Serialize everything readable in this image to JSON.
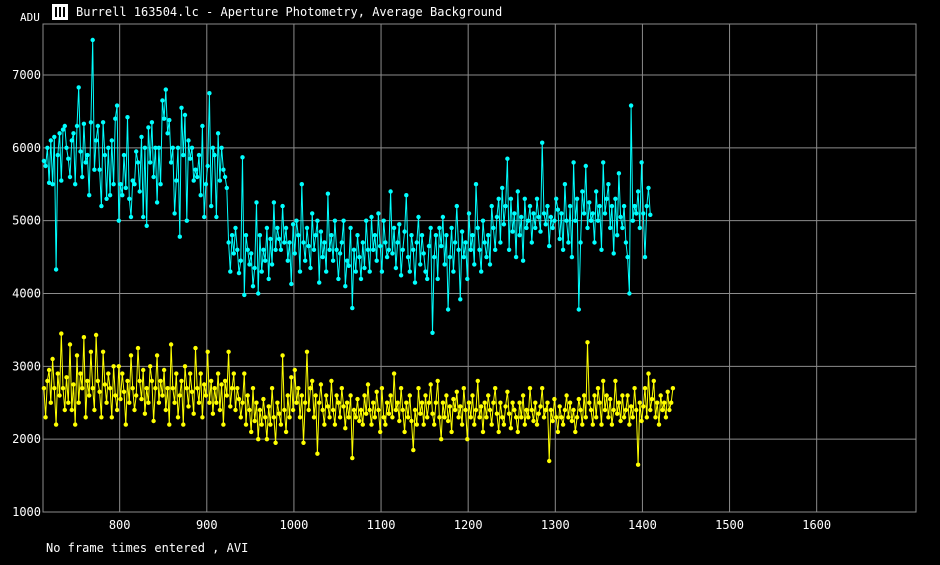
{
  "window": {
    "title": "Burrell 163504.lc - Aperture Photometry, Average Background",
    "icon": "lightcurve-app-icon"
  },
  "status_text": "No frame times entered , AVI",
  "colors": {
    "background": "#000000",
    "grid": "#8c8c8c",
    "series_target": "#00ffff",
    "series_comparison": "#ffff00",
    "text": "#ffffff"
  },
  "chart_data": {
    "type": "line",
    "title": "Burrell 163504.lc - Aperture Photometry, Average Background",
    "xlabel": "",
    "ylabel": "ADU",
    "xlim": [
      712,
      1714
    ],
    "ylim": [
      1000,
      7700
    ],
    "x_ticks": [
      800,
      900,
      1000,
      1100,
      1200,
      1300,
      1400,
      1500,
      1600
    ],
    "y_ticks": [
      1000,
      2000,
      3000,
      4000,
      5000,
      6000,
      7000
    ],
    "grid": true,
    "legend": "none",
    "markers": "filled-circle",
    "x_start": 713,
    "x_step": 2,
    "series": [
      {
        "color": "#00ffff",
        "values": [
          5820,
          5750,
          6000,
          5520,
          6100,
          5500,
          6150,
          4330,
          5900,
          6200,
          5550,
          6250,
          6300,
          6000,
          5850,
          5600,
          6100,
          6200,
          5500,
          6300,
          6830,
          5950,
          5600,
          6330,
          5800,
          5900,
          5350,
          6350,
          7480,
          5700,
          6100,
          6300,
          5700,
          5200,
          6350,
          5900,
          5300,
          6000,
          5350,
          6100,
          5500,
          6400,
          6580,
          5000,
          5500,
          5350,
          5900,
          5450,
          6420,
          5300,
          5050,
          5550,
          5500,
          5950,
          5800,
          5400,
          6150,
          5050,
          6000,
          4930,
          6280,
          5800,
          6350,
          5600,
          6000,
          5250,
          6000,
          5500,
          6650,
          6400,
          6800,
          6200,
          6380,
          5800,
          6000,
          5100,
          5550,
          6000,
          4780,
          6550,
          5900,
          6450,
          5000,
          6100,
          5850,
          6000,
          5550,
          5700,
          5600,
          5900,
          5350,
          6300,
          5050,
          5500,
          5750,
          6750,
          5200,
          6000,
          5900,
          5050,
          6200,
          5550,
          6000,
          5700,
          5600,
          5450,
          4700,
          4300,
          4800,
          4550,
          4900,
          4600,
          4280,
          4450,
          5870,
          3980,
          4800,
          4600,
          4400,
          4550,
          4100,
          4350,
          5250,
          4000,
          4800,
          4300,
          4600,
          4450,
          4900,
          4200,
          4750,
          4400,
          5250,
          4600,
          4900,
          4750,
          4600,
          5200,
          4700,
          4900,
          4450,
          4700,
          4130,
          4950,
          4550,
          5000,
          4800,
          4300,
          5500,
          4700,
          4450,
          4900,
          4650,
          4350,
          5100,
          4600,
          4800,
          5000,
          4150,
          4850,
          4500,
          4700,
          4300,
          5370,
          4600,
          4800,
          4450,
          5000,
          4600,
          4200,
          4550,
          4700,
          5000,
          4100,
          4450,
          4380,
          4900,
          3800,
          4600,
          4300,
          4800,
          4500,
          4200,
          4700,
          4350,
          5000,
          4600,
          4300,
          5050,
          4600,
          4800,
          4450,
          5100,
          4650,
          4300,
          5000,
          4700,
          4500,
          4600,
          5400,
          4550,
          4900,
          4350,
          4700,
          4950,
          4250,
          4600,
          4850,
          5350,
          4500,
          4300,
          4800,
          4600,
          4150,
          4700,
          5050,
          4400,
          4800,
          4550,
          4300,
          4200,
          4650,
          4900,
          3460,
          4500,
          4800,
          4200,
          4900,
          4650,
          5050,
          4400,
          4800,
          3780,
          4500,
          4900,
          4300,
          4700,
          5200,
          4600,
          3920,
          4850,
          4500,
          4700,
          4200,
          5100,
          4600,
          4800,
          4400,
          5500,
          4900,
          4600,
          4300,
          5000,
          4700,
          4500,
          4800,
          4400,
          5200,
          4900,
          4600,
          5050,
          5300,
          4700,
          5450,
          4950,
          5200,
          5850,
          4600,
          5300,
          4850,
          5100,
          4500,
          5400,
          4800,
          5050,
          4450,
          5300,
          4900,
          5000,
          5200,
          4700,
          5100,
          4900,
          5300,
          5050,
          4850,
          6070,
          5100,
          4950,
          5200,
          4650,
          5050,
          4900,
          5000,
          5300,
          5150,
          4750,
          5100,
          4600,
          5500,
          5000,
          4700,
          5200,
          4500,
          5800,
          5000,
          5300,
          3780,
          4700,
          5400,
          5100,
          5750,
          4900,
          5250,
          5000,
          5100,
          4700,
          5400,
          5000,
          5200,
          4600,
          5800,
          5100,
          5300,
          5500,
          4900,
          5200,
          4550,
          5300,
          4800,
          5650,
          5050,
          4900,
          5200,
          4700,
          4500,
          4000,
          6580,
          5000,
          5200,
          5100,
          5400,
          4900,
          5800,
          5100,
          4500,
          5200,
          5450,
          5080
        ]
      },
      {
        "color": "#ffff00",
        "values": [
          2700,
          2300,
          2800,
          2950,
          2500,
          3100,
          2700,
          2200,
          2900,
          2600,
          3450,
          2700,
          2400,
          2850,
          2500,
          3300,
          2400,
          2750,
          2200,
          3150,
          2500,
          2900,
          2700,
          3400,
          2300,
          2800,
          2600,
          3200,
          2700,
          2400,
          3430,
          2800,
          2650,
          2300,
          3200,
          2750,
          2500,
          2900,
          2700,
          2300,
          3000,
          2600,
          2400,
          3000,
          2550,
          2900,
          2650,
          2200,
          2800,
          2500,
          3150,
          2700,
          2400,
          2600,
          3250,
          2800,
          2550,
          2950,
          2350,
          2700,
          2500,
          3000,
          2800,
          2250,
          2700,
          3150,
          2500,
          2800,
          2600,
          2950,
          2400,
          2700,
          2200,
          3300,
          2700,
          2500,
          2900,
          2300,
          2600,
          2800,
          2200,
          3000,
          2700,
          2450,
          2900,
          2650,
          2350,
          3250,
          2700,
          2500,
          2900,
          2300,
          2750,
          2600,
          3200,
          2500,
          2800,
          2350,
          2700,
          2500,
          2900,
          2400,
          2750,
          2200,
          2800,
          2600,
          3200,
          2450,
          2700,
          2900,
          2400,
          2700,
          2550,
          2300,
          2500,
          2900,
          2200,
          2600,
          2400,
          2100,
          2700,
          2250,
          2500,
          2000,
          2400,
          2200,
          2550,
          2300,
          2000,
          2450,
          2200,
          2700,
          2300,
          1950,
          2500,
          2350,
          2200,
          3150,
          2400,
          2100,
          2600,
          2300,
          2850,
          2400,
          2950,
          2500,
          2700,
          2300,
          2600,
          1950,
          2500,
          3200,
          2400,
          2700,
          2800,
          2300,
          2600,
          1800,
          2500,
          2750,
          2400,
          2200,
          2600,
          2450,
          2300,
          2800,
          2400,
          2200,
          2600,
          2500,
          2300,
          2700,
          2450,
          2150,
          2500,
          2300,
          2600,
          1740,
          2400,
          2300,
          2550,
          2250,
          2400,
          2200,
          2600,
          2350,
          2750,
          2400,
          2200,
          2500,
          2300,
          2650,
          2400,
          2100,
          2700,
          2300,
          2200,
          2500,
          2350,
          2600,
          2300,
          2900,
          2400,
          2500,
          2250,
          2700,
          2400,
          2100,
          2500,
          2300,
          2600,
          2250,
          1850,
          2400,
          2200,
          2700,
          2350,
          2500,
          2200,
          2600,
          2300,
          2500,
          2750,
          2350,
          2200,
          2500,
          2800,
          2300,
          2000,
          2500,
          2300,
          2600,
          2250,
          2450,
          2100,
          2550,
          2400,
          2650,
          2300,
          2450,
          2200,
          2700,
          2400,
          2000,
          2500,
          2300,
          2600,
          2200,
          2400,
          2800,
          2300,
          2450,
          2100,
          2500,
          2300,
          2600,
          2400,
          2200,
          2500,
          2700,
          2350,
          2100,
          2500,
          2300,
          2200,
          2450,
          2650,
          2350,
          2150,
          2500,
          2400,
          2300,
          2100,
          2500,
          2300,
          2600,
          2200,
          2400,
          2300,
          2700,
          2400,
          2250,
          2500,
          2200,
          2350,
          2450,
          2700,
          2300,
          2400,
          2500,
          1700,
          2400,
          2250,
          2550,
          2300,
          2100,
          2450,
          2300,
          2200,
          2400,
          2600,
          2300,
          2500,
          2250,
          2400,
          2100,
          2300,
          2550,
          2400,
          2200,
          2600,
          2300,
          3330,
          2500,
          2400,
          2200,
          2600,
          2300,
          2700,
          2500,
          2200,
          2800,
          2400,
          2600,
          2300,
          2550,
          2200,
          2400,
          2800,
          2350,
          2500,
          2250,
          2600,
          2300,
          2400,
          2600,
          2200,
          2450,
          2300,
          2700,
          2400,
          1650,
          2500,
          2250,
          2450,
          2700,
          2300,
          2900,
          2400,
          2550,
          2800,
          2300,
          2500,
          2200,
          2600,
          2400,
          2500,
          2300,
          2650,
          2400,
          2500,
          2700
        ]
      }
    ]
  }
}
